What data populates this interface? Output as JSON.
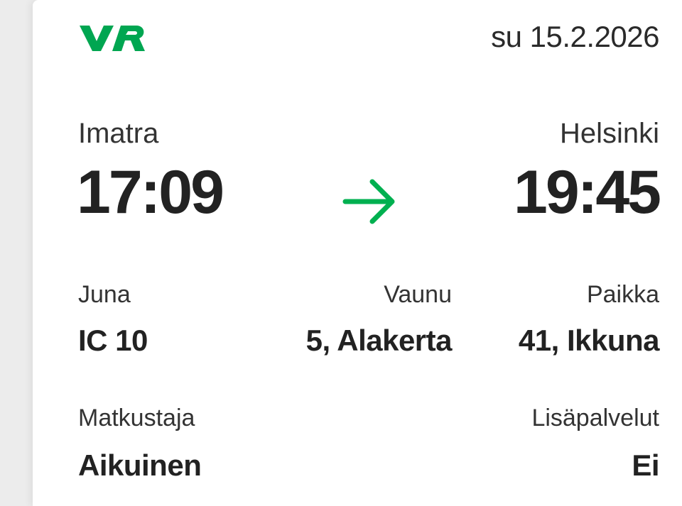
{
  "brand": {
    "logo_text": "VR",
    "color": "#00a651"
  },
  "ticket": {
    "date": "su 15.2.2026",
    "origin": {
      "station": "Imatra",
      "time": "17:09"
    },
    "destination": {
      "station": "Helsinki",
      "time": "19:45"
    },
    "arrow_icon": "arrow-right-icon",
    "arrow_color": "#00b050",
    "details": {
      "train": {
        "label": "Juna",
        "value": "IC 10"
      },
      "car": {
        "label": "Vaunu",
        "value": "5, Alakerta"
      },
      "seat": {
        "label": "Paikka",
        "value": "41, Ikkuna"
      },
      "passenger": {
        "label": "Matkustaja",
        "value": "Aikuinen"
      },
      "extras": {
        "label": "Lisäpalvelut",
        "value": "Ei"
      }
    }
  }
}
